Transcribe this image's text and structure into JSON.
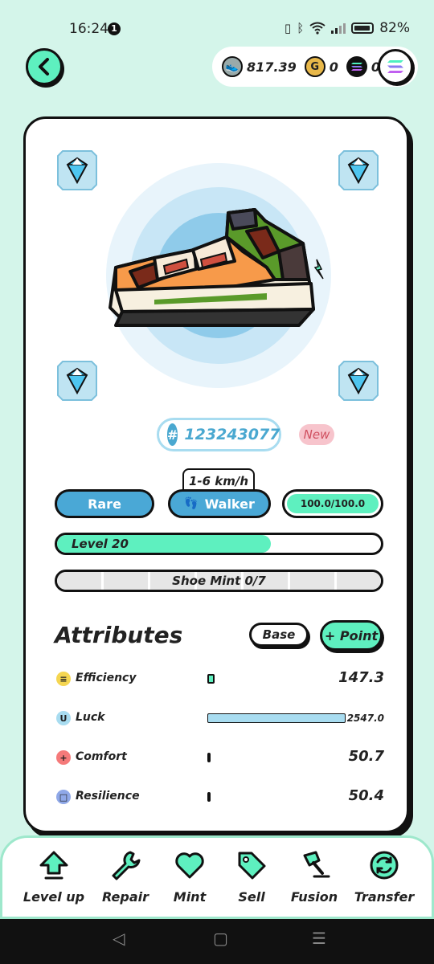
{
  "status_bar": {
    "time": "16:24",
    "notifications": "1",
    "battery": "82%"
  },
  "balances": [
    {
      "icon": "shoe-token-icon",
      "value": "817.39"
    },
    {
      "icon": "gold-coin-icon",
      "value": "0"
    },
    {
      "icon": "solana-icon",
      "value": "0"
    }
  ],
  "shoe": {
    "id_prefix": "#",
    "id": "123243077",
    "badge": "New",
    "speed": "1-6 km/h",
    "rarity": "Rare",
    "type": "Walker",
    "durability": "100.0/100.0",
    "level_label": "Level 20",
    "level_progress": 0.66,
    "mint_label": "Shoe Mint 0/7",
    "mint_count": 0,
    "mint_max": 7
  },
  "attributes": {
    "title": "Attributes",
    "base_label": "Base",
    "point_label": "+ Point",
    "items": [
      {
        "name": "Efficiency",
        "value": "147.3",
        "color": "#f5d651",
        "symbol": "≡",
        "fraction": 0.05
      },
      {
        "name": "Luck",
        "value": "2547.0",
        "color": "#a8dcf0",
        "symbol": "U",
        "fraction": 1.0
      },
      {
        "name": "Comfort",
        "value": "50.7",
        "color": "#f57a7a",
        "symbol": "+",
        "fraction": 0.01
      },
      {
        "name": "Resilience",
        "value": "50.4",
        "color": "#8fa8e8",
        "symbol": "□",
        "fraction": 0.01
      }
    ]
  },
  "actions": [
    {
      "label": "Level up",
      "icon": "level-up-arrow-icon"
    },
    {
      "label": "Repair",
      "icon": "wrench-icon"
    },
    {
      "label": "Mint",
      "icon": "heart-icon"
    },
    {
      "label": "Sell",
      "icon": "price-tag-icon"
    },
    {
      "label": "Fusion",
      "icon": "hammer-icon"
    },
    {
      "label": "Transfer",
      "icon": "transfer-icon"
    }
  ],
  "colors": {
    "accent": "#5ef0bf",
    "blue": "#4aa8d6",
    "background": "#d4f5ea"
  }
}
